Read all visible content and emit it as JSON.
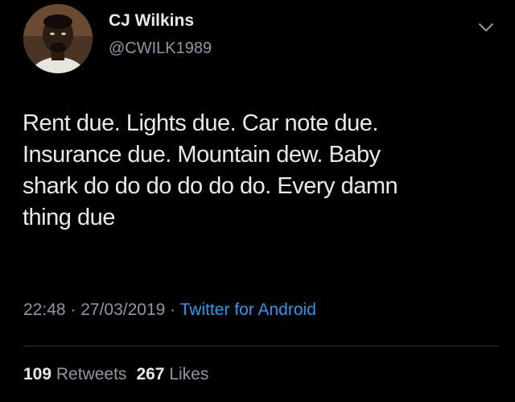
{
  "author": {
    "display_name": "CJ Wilkins",
    "handle": "@CWILK1989",
    "avatar_icon": "profile-photo"
  },
  "tweet": {
    "text": "Rent due. Lights due. Car note due.\nInsurance due. Mountain dew. Baby\nshark do do do do do do. Every damn\nthing due"
  },
  "meta": {
    "time": "22:48",
    "separator": " · ",
    "date": "27/03/2019",
    "source": "Twitter for Android"
  },
  "stats": {
    "retweets_count": "109",
    "retweets_label": "Retweets",
    "likes_count": "267",
    "likes_label": "Likes"
  },
  "colors": {
    "background": "#000000",
    "text": "#e7e9ea",
    "secondary": "#8b98a5",
    "link": "#1d9bf0"
  }
}
